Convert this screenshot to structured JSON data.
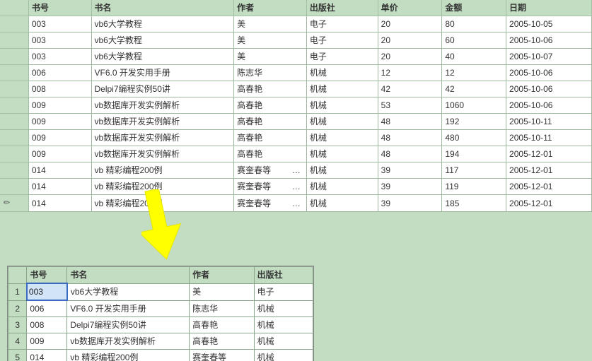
{
  "topGrid": {
    "headers": {
      "id": "书号",
      "name": "书名",
      "author": "作者",
      "publisher": "出版社",
      "price": "单价",
      "amount": "金额",
      "date": "日期"
    },
    "rows": [
      {
        "id": "003",
        "name": "vb6大学教程",
        "author": "美",
        "publisher": "电子",
        "price": "20",
        "amount": "80",
        "date": "2005-10-05",
        "editing": false,
        "ellipsis": false
      },
      {
        "id": "003",
        "name": "vb6大学教程",
        "author": "美",
        "publisher": "电子",
        "price": "20",
        "amount": "60",
        "date": "2005-10-06",
        "editing": false,
        "ellipsis": false
      },
      {
        "id": "003",
        "name": "vb6大学教程",
        "author": "美",
        "publisher": "电子",
        "price": "20",
        "amount": "40",
        "date": "2005-10-07",
        "editing": false,
        "ellipsis": false
      },
      {
        "id": "006",
        "name": "VF6.0 开发实用手册",
        "author": "陈志华",
        "publisher": "机械",
        "price": "12",
        "amount": "12",
        "date": "2005-10-06",
        "editing": false,
        "ellipsis": false
      },
      {
        "id": "008",
        "name": "Delpi7编程实例50讲",
        "author": "高春艳",
        "publisher": "机械",
        "price": "42",
        "amount": "42",
        "date": "2005-10-06",
        "editing": false,
        "ellipsis": false
      },
      {
        "id": "009",
        "name": "vb数据库开发实例解析",
        "author": "高春艳",
        "publisher": "机械",
        "price": "53",
        "amount": "1060",
        "date": "2005-10-06",
        "editing": false,
        "ellipsis": false
      },
      {
        "id": "009",
        "name": "vb数据库开发实例解析",
        "author": "高春艳",
        "publisher": "机械",
        "price": "48",
        "amount": "192",
        "date": "2005-10-11",
        "editing": false,
        "ellipsis": false
      },
      {
        "id": "009",
        "name": "vb数据库开发实例解析",
        "author": "高春艳",
        "publisher": "机械",
        "price": "48",
        "amount": "480",
        "date": "2005-10-11",
        "editing": false,
        "ellipsis": false
      },
      {
        "id": "009",
        "name": "vb数据库开发实例解析",
        "author": "高春艳",
        "publisher": "机械",
        "price": "48",
        "amount": "194",
        "date": "2005-12-01",
        "editing": false,
        "ellipsis": false
      },
      {
        "id": "014",
        "name": "vb 精彩编程200例",
        "author": "赛奎春等",
        "publisher": "机械",
        "price": "39",
        "amount": "117",
        "date": "2005-12-01",
        "editing": false,
        "ellipsis": true
      },
      {
        "id": "014",
        "name": "vb 精彩编程200例",
        "author": "赛奎春等",
        "publisher": "机械",
        "price": "39",
        "amount": "119",
        "date": "2005-12-01",
        "editing": false,
        "ellipsis": true
      },
      {
        "id": "014",
        "name": "vb 精彩编程200例",
        "author": "赛奎春等",
        "publisher": "机械",
        "price": "39",
        "amount": "185",
        "date": "2005-12-01",
        "editing": true,
        "ellipsis": true
      }
    ]
  },
  "bottomGrid": {
    "headers": {
      "id": "书号",
      "name": "书名",
      "author": "作者",
      "publisher": "出版社"
    },
    "rows": [
      {
        "n": "1",
        "id": "003",
        "name": "vb6大学教程",
        "author": "美",
        "publisher": "电子",
        "selected": true
      },
      {
        "n": "2",
        "id": "006",
        "name": "VF6.0 开发实用手册",
        "author": "陈志华",
        "publisher": "机械",
        "selected": false
      },
      {
        "n": "3",
        "id": "008",
        "name": "Delpi7编程实例50讲",
        "author": "高春艳",
        "publisher": "机械",
        "selected": false
      },
      {
        "n": "4",
        "id": "009",
        "name": "vb数据库开发实例解析",
        "author": "高春艳",
        "publisher": "机械",
        "selected": false
      },
      {
        "n": "5",
        "id": "014",
        "name": "vb 精彩编程200例",
        "author": "赛奎春等",
        "publisher": "机械",
        "selected": false
      }
    ]
  },
  "ellipsisMark": "…"
}
